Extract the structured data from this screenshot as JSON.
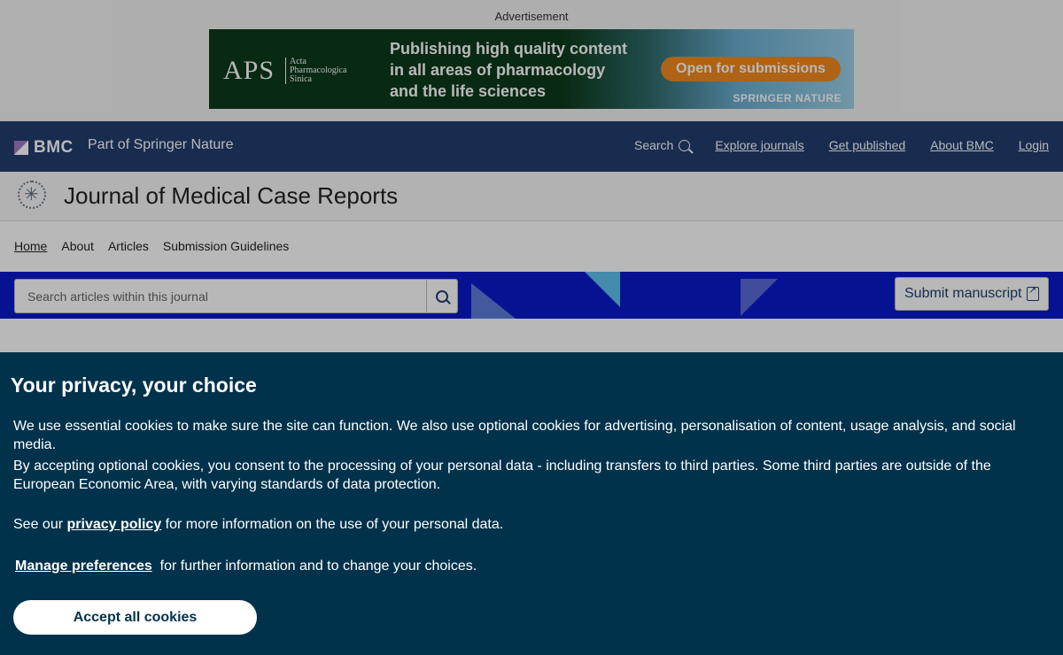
{
  "ad": {
    "label": "Advertisement",
    "logo": "APS",
    "logo_sub": "Acta\nPharmacologica\nSinica",
    "headline": "Publishing high quality content in all areas of pharmacology and the life sciences",
    "cta": "Open for submissions",
    "sponsor": "SPRINGER NATURE"
  },
  "header": {
    "brand": "BMC",
    "tagline": "Part of Springer Nature",
    "nav": {
      "search": "Search",
      "explore": "Explore journals",
      "publish": "Get published",
      "about": "About BMC",
      "login": "Login"
    }
  },
  "journal": {
    "title": "Journal of Medical Case Reports",
    "nav": {
      "home": "Home",
      "about": "About",
      "articles": "Articles",
      "guidelines": "Submission Guidelines"
    },
    "search_placeholder": "Search articles within this journal",
    "submit": "Submit manuscript"
  },
  "cookie": {
    "title": "Your privacy, your choice",
    "p1": "We use essential cookies to make sure the site can function. We also use optional cookies for advertising, personalisation of content, usage analysis, and social media.",
    "p2": "By accepting optional cookies, you consent to the processing of your personal data - including transfers to third parties. Some third parties are outside of the European Economic Area, with varying standards of data protection.",
    "p3_pre": "See our",
    "p3_link": "privacy policy",
    "p3_post": "for more information on the use of your personal data.",
    "p4_link": "Manage preferences",
    "p4_post": "for further information and to change your choices.",
    "accept": "Accept all cookies"
  }
}
